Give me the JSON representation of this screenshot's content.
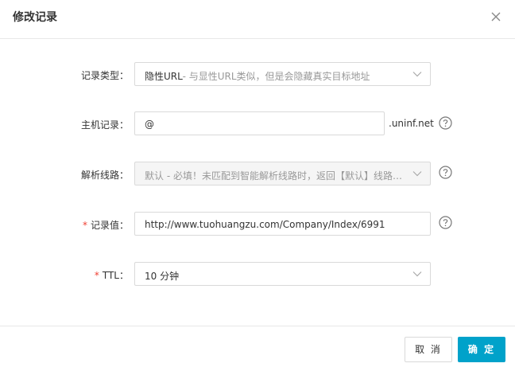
{
  "dialog": {
    "title": "修改记录",
    "close_icon": "close-icon"
  },
  "form": {
    "record_type": {
      "label": "记录类型：",
      "value_main": "隐性URL",
      "value_desc": "- 与显性URL类似，但是会隐藏真实目标地址"
    },
    "host": {
      "label": "主机记录：",
      "value": "@",
      "suffix": ".uninf.net"
    },
    "line": {
      "label": "解析线路：",
      "value_main": "默认",
      "value_desc": " - 必填！未匹配到智能解析线路时，返回【默认】线路…"
    },
    "record_value": {
      "required_mark": "*",
      "label": "记录值：",
      "value": "http://www.tuohuangzu.com/Company/Index/6991"
    },
    "ttl": {
      "required_mark": "*",
      "label": "TTL：",
      "value": "10 分钟"
    }
  },
  "footer": {
    "cancel_label": "取 消",
    "ok_label": "确 定"
  },
  "colors": {
    "primary": "#00a2ca",
    "required": "#f04134",
    "border": "#d9d9d9"
  }
}
